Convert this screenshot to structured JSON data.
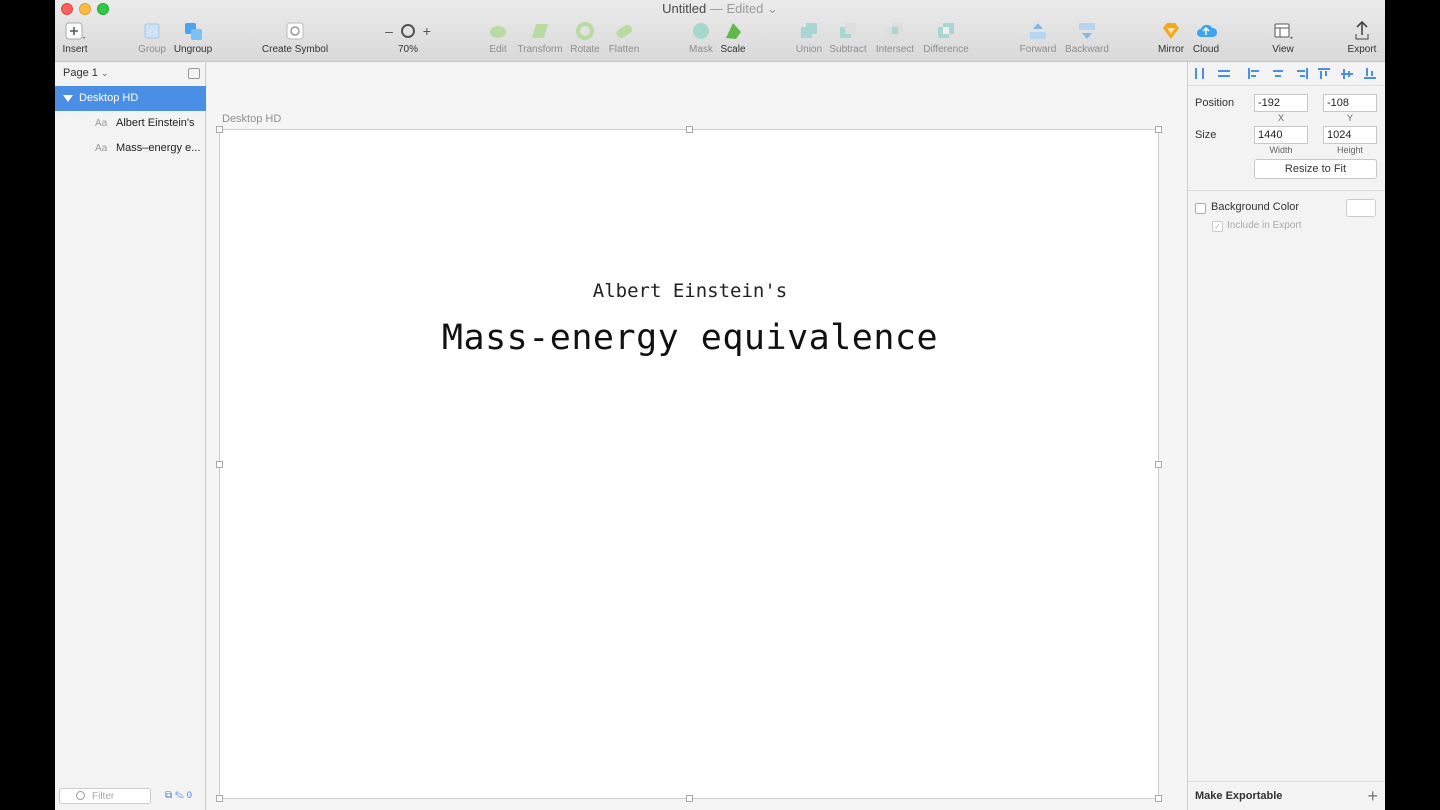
{
  "window": {
    "title": "Untitled",
    "edited_label": "— Edited",
    "accent_color": "#4b8ee5"
  },
  "toolbar": {
    "insert": "Insert",
    "group": "Group",
    "ungroup": "Ungroup",
    "create_symbol": "Create Symbol",
    "zoom_minus": "–",
    "zoom_plus": "+",
    "zoom_level": "70%",
    "edit": "Edit",
    "transform": "Transform",
    "rotate": "Rotate",
    "flatten": "Flatten",
    "mask": "Mask",
    "scale": "Scale",
    "union": "Union",
    "subtract": "Subtract",
    "intersect": "Intersect",
    "difference": "Difference",
    "forward": "Forward",
    "backward": "Backward",
    "mirror": "Mirror",
    "cloud": "Cloud",
    "view": "View",
    "export": "Export"
  },
  "sidebar": {
    "page": "Page 1",
    "layers": [
      {
        "label": "Desktop HD",
        "selected": true
      },
      {
        "label": "Albert Einstein's",
        "icon": "Aa"
      },
      {
        "label": "Mass–energy e...",
        "icon": "Aa"
      }
    ],
    "filter_placeholder": "Filter",
    "edit_count": "0"
  },
  "canvas": {
    "artboard_label": "Desktop HD",
    "subtitle": "Albert Einstein's",
    "heading": "Mass-energy equivalence"
  },
  "inspector": {
    "position_label": "Position",
    "x": "-192",
    "y": "-108",
    "x_label": "X",
    "y_label": "Y",
    "size_label": "Size",
    "width": "1440",
    "height": "1024",
    "width_label": "Width",
    "height_label": "Height",
    "resize_button": "Resize to Fit",
    "background_color": "Background Color",
    "include_in_export": "Include in Export",
    "make_exportable": "Make Exportable",
    "add": "+"
  }
}
